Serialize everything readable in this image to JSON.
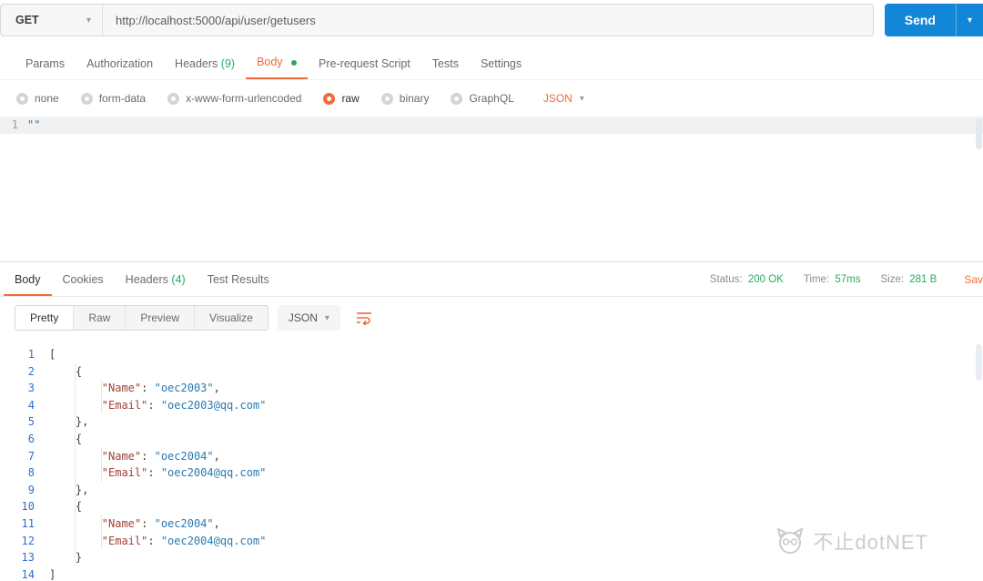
{
  "colors": {
    "accent_orange": "#f26b3a",
    "send_blue": "#1287d8",
    "status_green": "#27ae60",
    "line_number_blue": "#2f6fce",
    "json_key_red": "#a0413a",
    "json_value_blue": "#2a7ab0"
  },
  "icons": {
    "caret_down": "▾"
  },
  "request": {
    "method": "GET",
    "url": "http://localhost:5000/api/user/getusers",
    "send_label": "Send",
    "tabs": {
      "params": "Params",
      "authorization": "Authorization",
      "headers": "Headers",
      "headers_count": "(9)",
      "body": "Body",
      "prerequest": "Pre-request Script",
      "tests": "Tests",
      "settings": "Settings"
    },
    "body_types": {
      "none": "none",
      "form_data": "form-data",
      "urlencoded": "x-www-form-urlencoded",
      "raw": "raw",
      "binary": "binary",
      "graphql": "GraphQL"
    },
    "raw_format": "JSON",
    "editor": {
      "line_number": "1",
      "content": "\"\""
    }
  },
  "response": {
    "tabs": {
      "body": "Body",
      "cookies": "Cookies",
      "headers": "Headers",
      "headers_count": "(4)",
      "test_results": "Test Results"
    },
    "meta": {
      "status_label": "Status:",
      "status_value": "200 OK",
      "time_label": "Time:",
      "time_value": "57ms",
      "size_label": "Size:",
      "size_value": "281 B",
      "save_label": "Sav"
    },
    "view_tabs": {
      "pretty": "Pretty",
      "raw": "Raw",
      "preview": "Preview",
      "visualize": "Visualize"
    },
    "format": "JSON",
    "lines": [
      {
        "n": "1",
        "ind": 0,
        "txt": "["
      },
      {
        "n": "2",
        "ind": 1,
        "txt": "{"
      },
      {
        "n": "3",
        "ind": 2,
        "key": "\"Name\"",
        "sep": ": ",
        "val": "\"oec2003\"",
        "end": ","
      },
      {
        "n": "4",
        "ind": 2,
        "key": "\"Email\"",
        "sep": ": ",
        "val": "\"oec2003@qq.com\""
      },
      {
        "n": "5",
        "ind": 1,
        "txt": "},"
      },
      {
        "n": "6",
        "ind": 1,
        "txt": "{"
      },
      {
        "n": "7",
        "ind": 2,
        "key": "\"Name\"",
        "sep": ": ",
        "val": "\"oec2004\"",
        "end": ","
      },
      {
        "n": "8",
        "ind": 2,
        "key": "\"Email\"",
        "sep": ": ",
        "val": "\"oec2004@qq.com\""
      },
      {
        "n": "9",
        "ind": 1,
        "txt": "},"
      },
      {
        "n": "10",
        "ind": 1,
        "txt": "{"
      },
      {
        "n": "11",
        "ind": 2,
        "key": "\"Name\"",
        "sep": ": ",
        "val": "\"oec2004\"",
        "end": ","
      },
      {
        "n": "12",
        "ind": 2,
        "key": "\"Email\"",
        "sep": ": ",
        "val": "\"oec2004@qq.com\""
      },
      {
        "n": "13",
        "ind": 1,
        "txt": "}"
      },
      {
        "n": "14",
        "ind": 0,
        "txt": "]"
      }
    ]
  },
  "watermark": {
    "text": "不止dotNET"
  }
}
